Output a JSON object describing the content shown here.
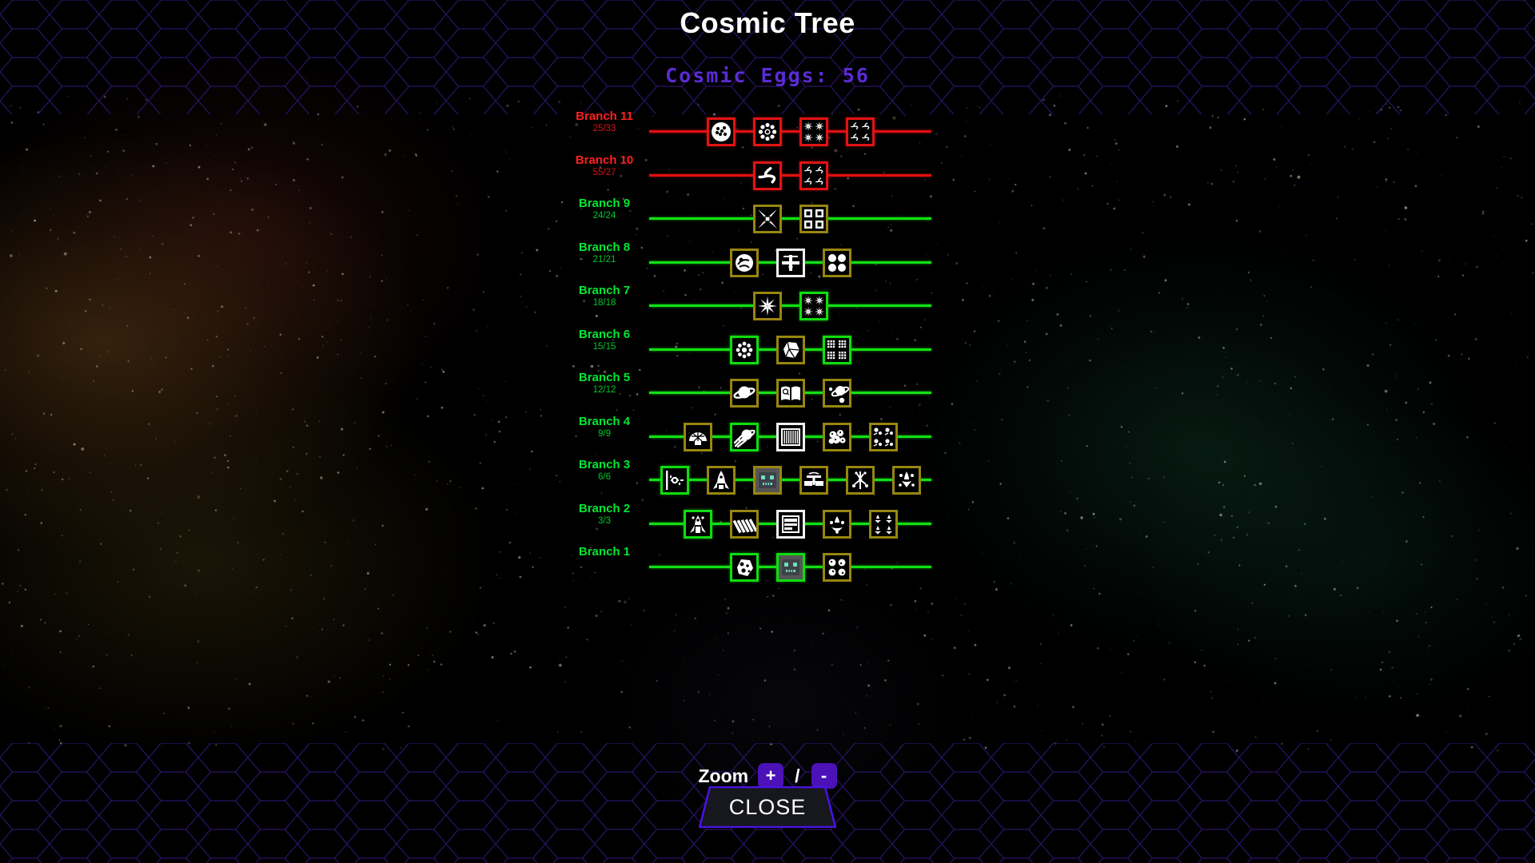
{
  "header": {
    "title": "Cosmic Tree",
    "eggs_label": "Cosmic Eggs: 56",
    "eggs_color": "#5b2bd6"
  },
  "colors": {
    "branch_unlocked": "#00e832",
    "branch_locked": "#ff2020",
    "line_green": "#12e012",
    "line_red": "#e01010",
    "node_gold": "#97860f",
    "node_green": "#10dd10",
    "node_red": "#e21313",
    "node_white": "#f2f2f2",
    "zoom_button": "#4b12b8",
    "close_border": "#4b12e8"
  },
  "branches": [
    {
      "name": "Branch 11",
      "count": "25/33",
      "state": "locked",
      "line": "red",
      "nodes": [
        {
          "icon": "cluster-blob-icon",
          "border": "red",
          "fill": "dark"
        },
        {
          "icon": "snowflake-burst-icon",
          "border": "red",
          "fill": "dark"
        },
        {
          "icon": "quad-star-grid-icon",
          "border": "red",
          "fill": "dark"
        },
        {
          "icon": "quad-spiral-icon",
          "border": "red",
          "fill": "dark"
        }
      ]
    },
    {
      "name": "Branch 10",
      "count": "55/27",
      "state": "locked",
      "line": "red",
      "nodes": [
        {
          "icon": "triple-spiral-icon",
          "border": "red",
          "fill": "dark"
        },
        {
          "icon": "quad-spiral-small-icon",
          "border": "red",
          "fill": "dark"
        }
      ]
    },
    {
      "name": "Branch 9",
      "count": "24/24",
      "state": "unlocked",
      "line": "green",
      "nodes": [
        {
          "icon": "star-portal-icon",
          "border": "gold",
          "fill": "dark"
        },
        {
          "icon": "quad-block-grid-icon",
          "border": "gold",
          "fill": "dark"
        }
      ]
    },
    {
      "name": "Branch 8",
      "count": "21/21",
      "state": "unlocked",
      "line": "green",
      "nodes": [
        {
          "icon": "swirl-planet-icon",
          "border": "gold",
          "fill": "dark"
        },
        {
          "icon": "station-platform-icon",
          "border": "white",
          "fill": "dark"
        },
        {
          "icon": "four-moons-icon",
          "border": "gold",
          "fill": "dark"
        }
      ]
    },
    {
      "name": "Branch 7",
      "count": "18/18",
      "state": "unlocked",
      "line": "green",
      "nodes": [
        {
          "icon": "eight-point-star-icon",
          "border": "gold",
          "fill": "dark"
        },
        {
          "icon": "four-star-grid-icon",
          "border": "green",
          "fill": "dark"
        }
      ]
    },
    {
      "name": "Branch 6",
      "count": "15/15",
      "state": "unlocked",
      "line": "green",
      "nodes": [
        {
          "icon": "flower-burst-icon",
          "border": "green",
          "fill": "dark"
        },
        {
          "icon": "rock-fragment-icon",
          "border": "gold",
          "fill": "dark"
        },
        {
          "icon": "grid-cells-icon",
          "border": "green",
          "fill": "dark"
        }
      ]
    },
    {
      "name": "Branch 5",
      "count": "12/12",
      "state": "unlocked",
      "line": "green",
      "nodes": [
        {
          "icon": "ringed-planet-icon",
          "border": "gold",
          "fill": "dark"
        },
        {
          "icon": "open-book-icon",
          "border": "gold",
          "fill": "dark"
        },
        {
          "icon": "planet-moons-icon",
          "border": "gold",
          "fill": "dark"
        }
      ]
    },
    {
      "name": "Branch 4",
      "count": "9/9",
      "state": "unlocked",
      "line": "green",
      "nodes": [
        {
          "icon": "geodesic-dome-icon",
          "border": "gold",
          "fill": "dark"
        },
        {
          "icon": "comet-streak-icon",
          "border": "green",
          "fill": "dark"
        },
        {
          "icon": "barcode-panel-icon",
          "border": "white",
          "fill": "dark"
        },
        {
          "icon": "asteroid-cluster-icon",
          "border": "gold",
          "fill": "dark"
        },
        {
          "icon": "debris-field-icon",
          "border": "gold",
          "fill": "dark"
        }
      ]
    },
    {
      "name": "Branch 3",
      "count": "6/6",
      "state": "unlocked",
      "line": "green",
      "nodes": [
        {
          "icon": "launch-rail-icon",
          "border": "green",
          "fill": "dark"
        },
        {
          "icon": "rocket-ship-icon",
          "border": "gold",
          "fill": "dark"
        },
        {
          "icon": "robot-face-icon",
          "border": "gold",
          "fill": "grey"
        },
        {
          "icon": "satellite-dish-icon",
          "border": "gold",
          "fill": "dark"
        },
        {
          "icon": "probe-array-icon",
          "border": "gold",
          "fill": "dark"
        },
        {
          "icon": "shuttle-pair-icon",
          "border": "gold",
          "fill": "dark"
        }
      ]
    },
    {
      "name": "Branch 2",
      "count": "3/3",
      "state": "unlocked",
      "line": "green",
      "nodes": [
        {
          "icon": "lander-craft-icon",
          "border": "green",
          "fill": "dark"
        },
        {
          "icon": "solar-array-icon",
          "border": "gold",
          "fill": "dark"
        },
        {
          "icon": "server-rack-icon",
          "border": "white",
          "fill": "dark"
        },
        {
          "icon": "satellite-trio-icon",
          "border": "gold",
          "fill": "dark"
        },
        {
          "icon": "fleet-grid-icon",
          "border": "gold",
          "fill": "dark"
        }
      ]
    },
    {
      "name": "Branch 1",
      "count": "",
      "state": "unlocked",
      "line": "green",
      "nodes": [
        {
          "icon": "asteroid-icon",
          "border": "green",
          "fill": "dark"
        },
        {
          "icon": "robot-face-icon",
          "border": "green",
          "fill": "grey"
        },
        {
          "icon": "moon-cluster-icon",
          "border": "gold",
          "fill": "dark"
        }
      ]
    }
  ],
  "controls": {
    "zoom_label": "Zoom",
    "zoom_in": "+",
    "zoom_separator": "/",
    "zoom_out": "-",
    "close_label": "CLOSE"
  }
}
